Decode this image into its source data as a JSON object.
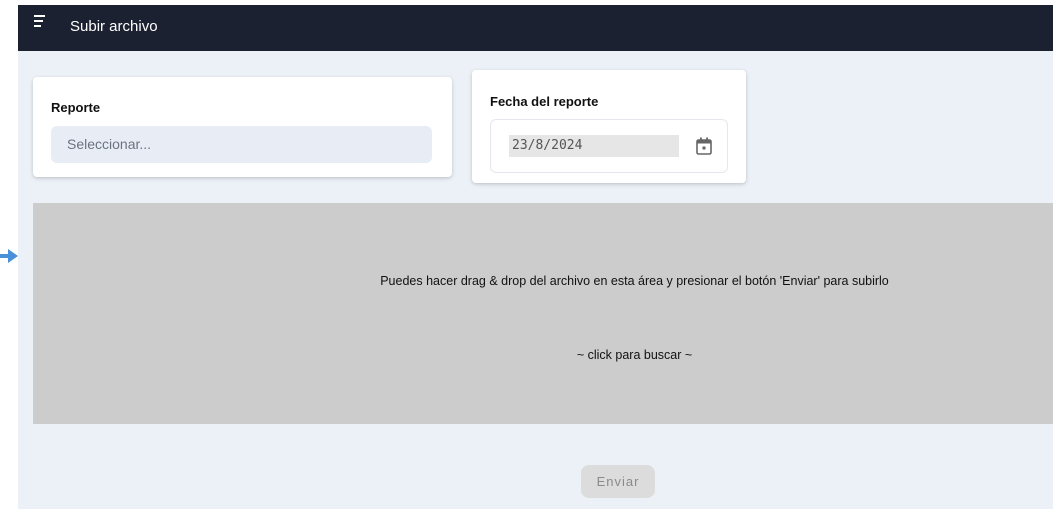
{
  "header": {
    "title": "Subir archivo",
    "menu_icon": "hamburger-menu-icon"
  },
  "form": {
    "report": {
      "label": "Reporte",
      "placeholder": "Seleccionar..."
    },
    "date": {
      "label": "Fecha del reporte",
      "value": "23/8/2024",
      "icon": "calendar-icon"
    }
  },
  "dropzone": {
    "instructions": "Puedes hacer drag & drop del archivo en esta área y presionar el botón 'Enviar' para subirlo",
    "click_text": "~ click para buscar ~"
  },
  "actions": {
    "send_label": "Enviar"
  },
  "colors": {
    "topbar": "#1b2130",
    "background": "#ebf1f7",
    "dropzone": "#cccccc",
    "arrow": "#4a90d9"
  }
}
